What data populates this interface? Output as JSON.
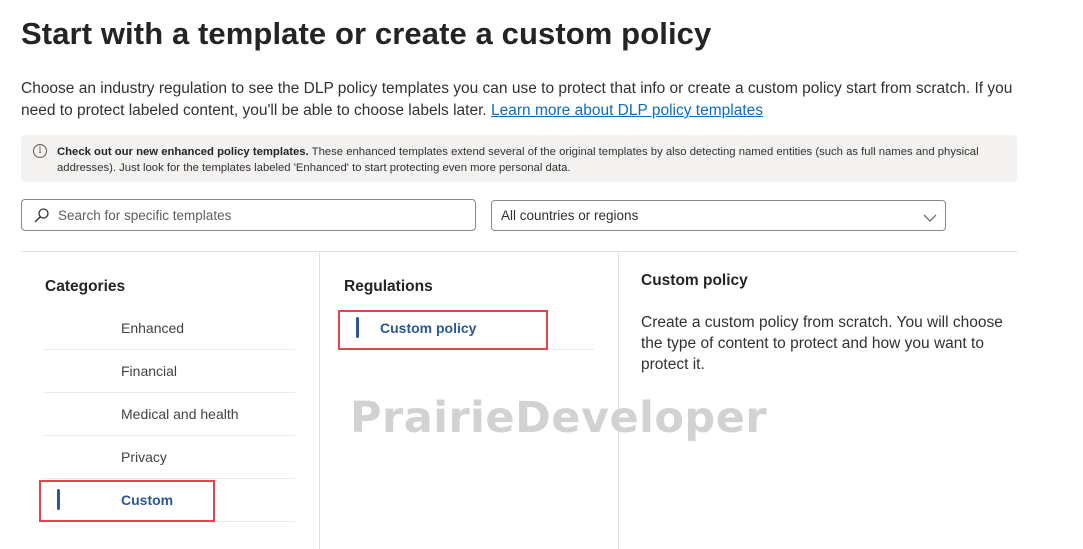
{
  "header": {
    "title": "Start with a template or create a custom policy",
    "description": "Choose an industry regulation to see the DLP policy templates you can use to protect that info or create a custom policy start from scratch. If you need to protect labeled content, you'll be able to choose labels later.",
    "learn_more_link": "Learn more about DLP policy templates"
  },
  "banner": {
    "icon": "info-icon",
    "bold_text": "Check out our new enhanced policy templates.",
    "text": "These enhanced templates extend several of the original templates by also detecting named entities (such as full names and physical addresses). Just look for the templates labeled 'Enhanced' to start protecting even more personal data."
  },
  "search": {
    "placeholder": "Search for specific templates",
    "value": ""
  },
  "region_select": {
    "selected": "All countries or regions"
  },
  "categories": {
    "heading": "Categories",
    "items": [
      {
        "label": "Enhanced"
      },
      {
        "label": "Financial"
      },
      {
        "label": "Medical and health"
      },
      {
        "label": "Privacy"
      },
      {
        "label": "Custom",
        "selected": true
      }
    ]
  },
  "regulations": {
    "heading": "Regulations",
    "items": [
      {
        "label": "Custom policy",
        "selected": true
      }
    ]
  },
  "details": {
    "title": "Custom policy",
    "description": "Create a custom policy from scratch. You will choose the type of content to protect and how you want to protect it."
  },
  "watermark": "PrairieDeveloper",
  "colors": {
    "accent": "#2b5796",
    "link": "#0f6cbd",
    "highlight_box": "#e0464b",
    "banner_bg": "#f3f2f1"
  }
}
